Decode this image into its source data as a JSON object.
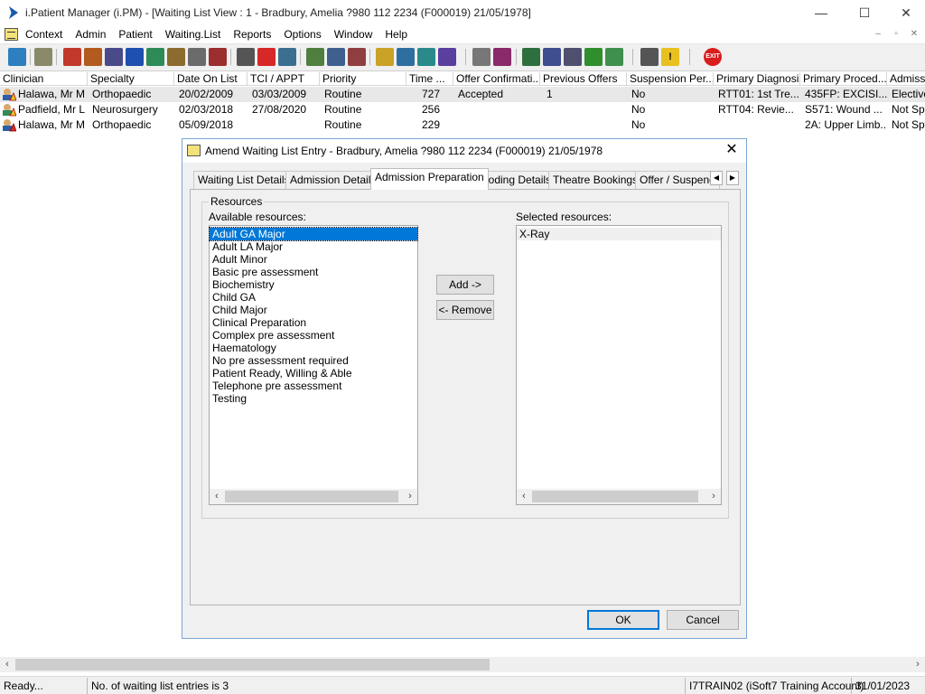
{
  "window": {
    "title": "i.Patient Manager (i.PM) - [Waiting List View :  1 - Bradbury, Amelia ?980 112 2234 (F000019) 21/05/1978]",
    "minimize": "—",
    "maximize": "☐",
    "close": "✕"
  },
  "menu": {
    "items": [
      "Context",
      "Admin",
      "Patient",
      "Waiting.List",
      "Reports",
      "Options",
      "Window",
      "Help"
    ],
    "mdi": [
      "–",
      "▫",
      "✕"
    ]
  },
  "toolbar": {
    "exit_label": "EXIT"
  },
  "grid": {
    "columns": [
      "Clinician",
      "Specialty",
      "Date On List",
      "TCI / APPT",
      "Priority",
      "Time ...",
      "Offer Confirmati...",
      "Previous Offers",
      "Suspension Per...",
      "Primary Diagnosis",
      "Primary Proced...",
      "Admissi"
    ],
    "rows": [
      [
        "Halawa, Mr M",
        "Orthopaedic",
        "20/02/2009",
        "03/03/2009",
        "Routine",
        "727",
        "Accepted",
        "1",
        "No",
        "RTT01: 1st Tre...",
        "435FP: EXCISI...",
        "Elective"
      ],
      [
        "Padfield, Mr L",
        "Neurosurgery",
        "02/03/2018",
        "27/08/2020",
        "Routine",
        "256",
        "",
        "",
        "No",
        "RTT04: Revie...",
        "S571: Wound ...",
        "Not Spe"
      ],
      [
        "Halawa, Mr M",
        "Orthopaedic",
        "05/09/2018",
        "",
        "Routine",
        "229",
        "",
        "",
        "No",
        "",
        "2A: Upper Limb...",
        "Not Spe"
      ]
    ]
  },
  "dialog": {
    "title": "Amend Waiting List Entry - Bradbury, Amelia ?980 112 2234 (F000019) 21/05/1978",
    "close": "✕",
    "tabs": [
      "Waiting List Details",
      "Admission Details",
      "Admission Preparation",
      "Coding Details",
      "Theatre Bookings",
      "Offer / Suspend"
    ],
    "active_tab": "Admission Preparation",
    "group_label": "Resources",
    "available_label": "Available resources:",
    "selected_label": "Selected resources:",
    "available": [
      "Adult GA Major",
      "Adult LA Major",
      "Adult Minor",
      "Basic pre assessment",
      "Biochemistry",
      "Child GA",
      "Child Major",
      "Clinical Preparation",
      "Complex pre assessment",
      "Haematology",
      "No pre assessment required",
      "Patient Ready, Willing & Able",
      "Telephone pre assessment",
      "Testing"
    ],
    "selected_available": "Adult GA Major",
    "selected": [
      "X-Ray"
    ],
    "add_button": "Add ->",
    "remove_button": "<- Remove",
    "ok_button": "OK",
    "cancel_button": "Cancel"
  },
  "statusbar": {
    "status": "Ready...",
    "entries": "No. of waiting list entries is 3",
    "account": "I7TRAIN02 (iSoft7 Training Account)",
    "date": "31/01/2023"
  }
}
